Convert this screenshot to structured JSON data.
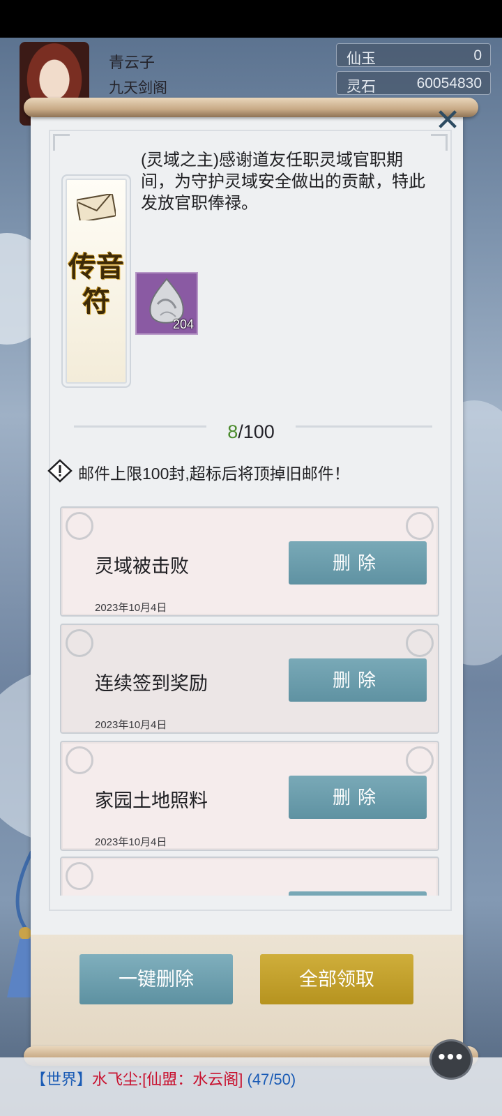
{
  "player": {
    "name": "青云子",
    "sect": "九天剑阁"
  },
  "resources": [
    {
      "label": "仙玉",
      "value": "0"
    },
    {
      "label": "灵石",
      "value": "60054830"
    }
  ],
  "mail_detail": {
    "card_title": "传音符",
    "body": "(灵域之主)感谢道友任职灵域官职期间，为守护灵域安全做出的贡献，特此发放官职俸禄。",
    "reward_count": "204"
  },
  "mailbox": {
    "count_current": "8",
    "count_max": "/100",
    "warning": "邮件上限100封,超标后将顶掉旧邮件！"
  },
  "mails": [
    {
      "title": "灵域被击败",
      "date": "2023年10月4日",
      "action": "删除"
    },
    {
      "title": "连续签到奖励",
      "date": "2023年10月4日",
      "action": "删除"
    },
    {
      "title": "家园土地照料",
      "date": "2023年10月4日",
      "action": "删除"
    }
  ],
  "actions": {
    "delete_all": "一键删除",
    "claim_all": "全部领取"
  },
  "chat": {
    "channel": "【世界】",
    "speaker": "水飞尘:",
    "content": "[仙盟：水云阁]",
    "counter": "(47/50)"
  },
  "colors": {
    "delete_button": "#6a9cab",
    "claim_button": "#c4a22c",
    "count_highlight": "#4a8a2c"
  }
}
